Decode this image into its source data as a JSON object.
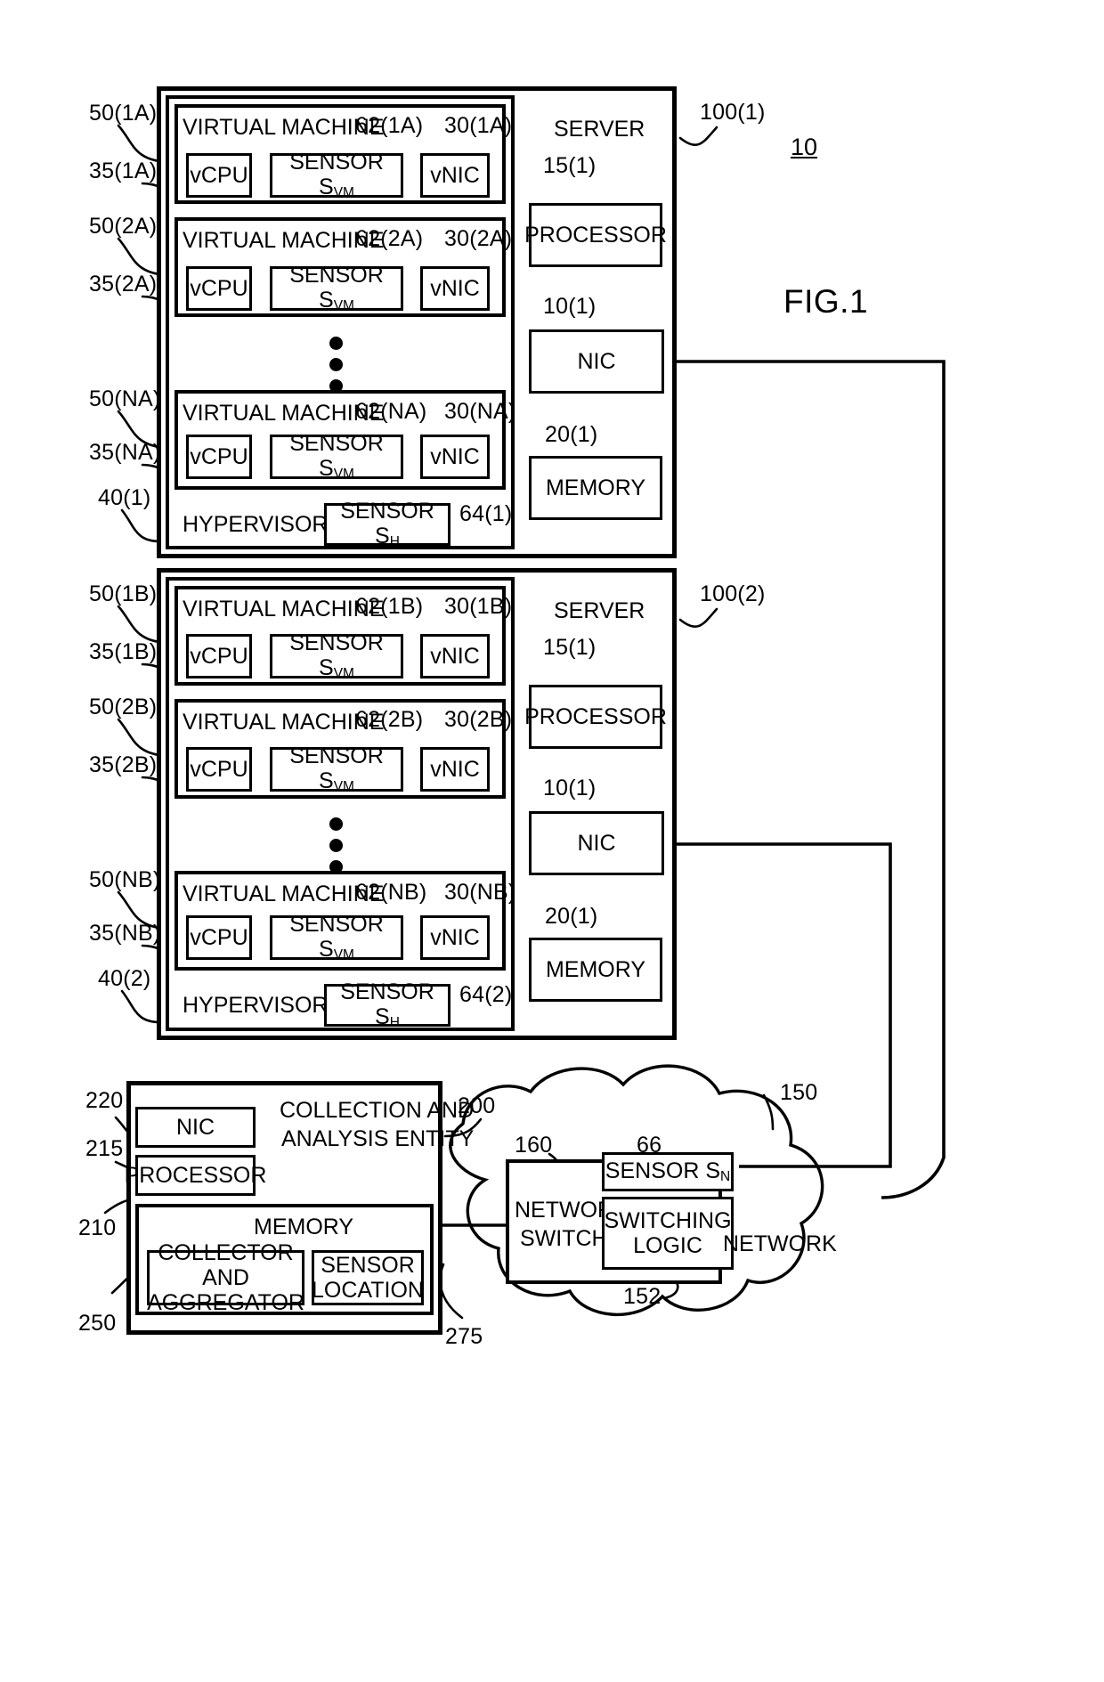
{
  "figure": {
    "label": "FIG.1",
    "system_ref": "10"
  },
  "servers": [
    {
      "ref": "100(1)",
      "title": "SERVER",
      "hypervisor": {
        "label": "HYPERVISOR",
        "ref": "40(1)",
        "sensor": {
          "label": "SENSOR S",
          "sub": "H",
          "ref": "64(1)"
        }
      },
      "processor": {
        "label": "PROCESSOR",
        "ref": "15(1)"
      },
      "nic": {
        "label": "NIC",
        "ref": "10(1)"
      },
      "memory": {
        "label": "MEMORY",
        "ref": "20(1)"
      },
      "vms": [
        {
          "title": "VIRTUAL MACHINE",
          "vm_ref": "50(1A)",
          "vcpu": {
            "label": "vCPU",
            "ref": "35(1A)"
          },
          "sensor": {
            "label": "SENSOR S",
            "sub": "VM",
            "ref": "62(1A)"
          },
          "vnic": {
            "label": "vNIC",
            "ref": "30(1A)"
          }
        },
        {
          "title": "VIRTUAL MACHINE",
          "vm_ref": "50(2A)",
          "vcpu": {
            "label": "vCPU",
            "ref": "35(2A)"
          },
          "sensor": {
            "label": "SENSOR S",
            "sub": "VM",
            "ref": "62(2A)"
          },
          "vnic": {
            "label": "vNIC",
            "ref": "30(2A)"
          }
        },
        {
          "title": "VIRTUAL MACHINE",
          "vm_ref": "50(NA)",
          "vcpu": {
            "label": "vCPU",
            "ref": "35(NA)"
          },
          "sensor": {
            "label": "SENSOR S",
            "sub": "VM",
            "ref": "62(NA)"
          },
          "vnic": {
            "label": "vNIC",
            "ref": "30(NA)"
          }
        }
      ]
    },
    {
      "ref": "100(2)",
      "title": "SERVER",
      "hypervisor": {
        "label": "HYPERVISOR",
        "ref": "40(2)",
        "sensor": {
          "label": "SENSOR S",
          "sub": "H",
          "ref": "64(2)"
        }
      },
      "processor": {
        "label": "PROCESSOR",
        "ref": "15(1)"
      },
      "nic": {
        "label": "NIC",
        "ref": "10(1)"
      },
      "memory": {
        "label": "MEMORY",
        "ref": "20(1)"
      },
      "vms": [
        {
          "title": "VIRTUAL MACHINE",
          "vm_ref": "50(1B)",
          "vcpu": {
            "label": "vCPU",
            "ref": "35(1B)"
          },
          "sensor": {
            "label": "SENSOR S",
            "sub": "VM",
            "ref": "62(1B)"
          },
          "vnic": {
            "label": "vNIC",
            "ref": "30(1B)"
          }
        },
        {
          "title": "VIRTUAL MACHINE",
          "vm_ref": "50(2B)",
          "vcpu": {
            "label": "vCPU",
            "ref": "35(2B)"
          },
          "sensor": {
            "label": "SENSOR S",
            "sub": "VM",
            "ref": "62(2B)"
          },
          "vnic": {
            "label": "vNIC",
            "ref": "30(2B)"
          }
        },
        {
          "title": "VIRTUAL MACHINE",
          "vm_ref": "50(NB)",
          "vcpu": {
            "label": "vCPU",
            "ref": "35(NB)"
          },
          "sensor": {
            "label": "SENSOR S",
            "sub": "VM",
            "ref": "62(NB)"
          },
          "vnic": {
            "label": "vNIC",
            "ref": "30(NB)"
          }
        }
      ]
    }
  ],
  "collection_entity": {
    "ref": "200",
    "title_line1": "COLLECTION AND",
    "title_line2": "ANALYSIS ENTITY",
    "nic": {
      "label": "NIC",
      "ref": "220"
    },
    "processor": {
      "label": "PROCESSOR",
      "ref": "215"
    },
    "memory": {
      "label": "MEMORY",
      "ref": "210"
    },
    "collector": {
      "line1": "COLLECTOR AND",
      "line2": "AGGREGATOR",
      "ref": "250"
    },
    "sensor_location": {
      "line1": "SENSOR",
      "line2": "LOCATION",
      "ref": "275"
    }
  },
  "network": {
    "label": "NETWORK",
    "ref": "150",
    "switch": {
      "line1": "NETWORK",
      "line2": "SWITCH",
      "ref": "160",
      "sensor": {
        "label": "SENSOR S",
        "sub": "N",
        "ref": "66"
      },
      "logic": {
        "line1": "SWITCHING",
        "line2": "LOGIC",
        "ref": "152"
      }
    }
  }
}
